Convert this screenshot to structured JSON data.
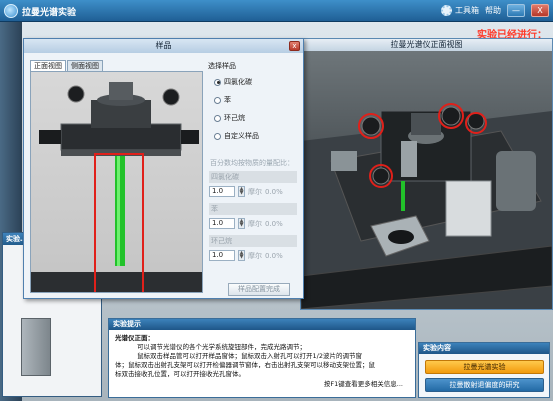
{
  "app": {
    "title": "拉曼光谱实验"
  },
  "topbar": {
    "tools_label": "工具箱",
    "help_label": "帮助",
    "min_label": "—",
    "close_label": "X"
  },
  "status": {
    "running": "实验已经进行："
  },
  "view_window": {
    "title": "拉曼光谱仪正面视图"
  },
  "side_panel": {
    "title": "实验…"
  },
  "dialog": {
    "title": "样品",
    "close_label": "x",
    "tabs": [
      {
        "label": "正面视图",
        "active": true
      },
      {
        "label": "侧面视图",
        "active": false
      }
    ],
    "options": {
      "title": "选择样品",
      "samples": [
        {
          "label": "四氯化碳",
          "selected": true
        },
        {
          "label": "苯",
          "selected": false
        },
        {
          "label": "环己烷",
          "selected": false
        },
        {
          "label": "自定义样品",
          "selected": false
        }
      ],
      "ratio_label": "百分数均按物质的量配比：",
      "components": [
        {
          "name": "四氯化碳",
          "value": "1.0",
          "unit": "摩尔",
          "percent": "0.0%"
        },
        {
          "name": "苯",
          "value": "1.0",
          "unit": "摩尔",
          "percent": "0.0%"
        },
        {
          "name": "环己烷",
          "value": "1.0",
          "unit": "摩尔",
          "percent": "0.0%"
        }
      ],
      "done_label": "样品配置完成"
    }
  },
  "hint_panel": {
    "title": "实验提示",
    "heading": "光谱仪正面：",
    "lines": [
      "可以调节光谱仪的各个光学系统旋钮部件，完成光路调节；",
      "鼠标双击样品管可以打开样品窗体；鼠标双击入射孔可以打开1/2波片的调节窗",
      "体；鼠标双击出射孔支架可以打开检偏器调节窗体，右击出射孔支架可以移动支架位置；鼠",
      "标双击接收孔位置，可以打开接收光孔窗体。"
    ],
    "footer": "按F1键查看更多相关信息..."
  },
  "content_panel": {
    "title": "实验内容",
    "buttons": [
      {
        "label": "拉曼光谱实验"
      },
      {
        "label": "拉曼散射退偏度的研究"
      }
    ]
  },
  "colors": {
    "laser_green": "#22c22a",
    "highlight_red": "#e0201a",
    "status_red": "#ff3a2a",
    "accent_orange": "#f39b0d",
    "titlebar_blue": "#1f5f95"
  }
}
